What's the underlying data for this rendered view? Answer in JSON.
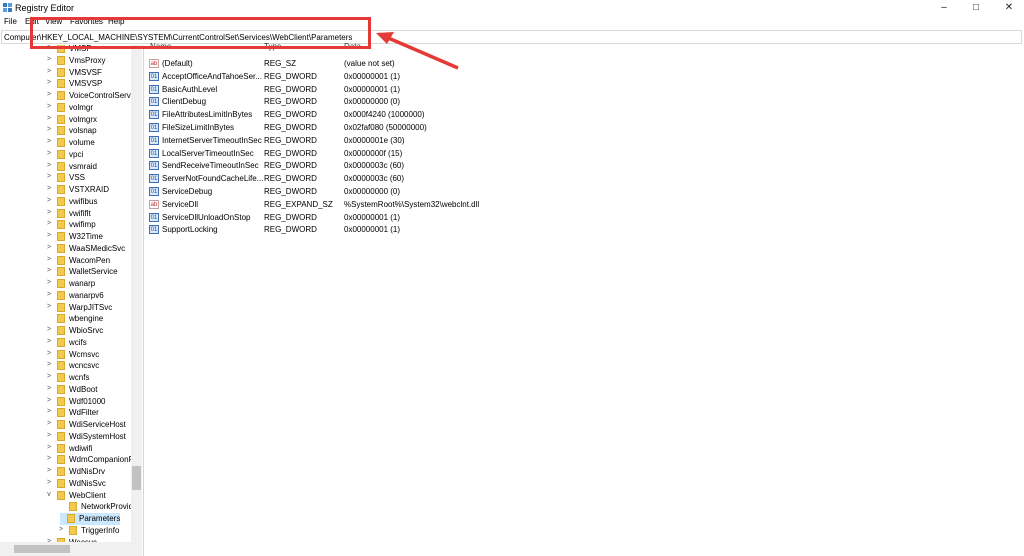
{
  "window": {
    "title": "Registry Editor",
    "controls": [
      {
        "name": "minimize-button",
        "glyph": "–"
      },
      {
        "name": "maximize-button",
        "glyph": "□"
      },
      {
        "name": "close-button",
        "glyph": "✕"
      }
    ]
  },
  "menu": [
    "File",
    "Edit",
    "View",
    "Favorites",
    "Help"
  ],
  "address": "Computer\\HKEY_LOCAL_MACHINE\\SYSTEM\\CurrentControlSet\\Services\\WebClient\\Parameters",
  "tree": [
    {
      "label": "VMSP",
      "chev": ">",
      "depth": 0
    },
    {
      "label": "VmsProxy",
      "chev": ">",
      "depth": 0
    },
    {
      "label": "VMSVSF",
      "chev": ">",
      "depth": 0
    },
    {
      "label": "VMSVSP",
      "chev": ">",
      "depth": 0
    },
    {
      "label": "VoiceControlServi",
      "chev": ">",
      "depth": 0
    },
    {
      "label": "volmgr",
      "chev": ">",
      "depth": 0
    },
    {
      "label": "volmgrx",
      "chev": ">",
      "depth": 0
    },
    {
      "label": "volsnap",
      "chev": ">",
      "depth": 0
    },
    {
      "label": "volume",
      "chev": ">",
      "depth": 0
    },
    {
      "label": "vpci",
      "chev": ">",
      "depth": 0
    },
    {
      "label": "vsmraid",
      "chev": ">",
      "depth": 0
    },
    {
      "label": "VSS",
      "chev": ">",
      "depth": 0
    },
    {
      "label": "VSTXRAID",
      "chev": ">",
      "depth": 0
    },
    {
      "label": "vwifibus",
      "chev": ">",
      "depth": 0
    },
    {
      "label": "vwififlt",
      "chev": ">",
      "depth": 0
    },
    {
      "label": "vwifimp",
      "chev": ">",
      "depth": 0
    },
    {
      "label": "W32Time",
      "chev": ">",
      "depth": 0
    },
    {
      "label": "WaaSMedicSvc",
      "chev": ">",
      "depth": 0
    },
    {
      "label": "WacomPen",
      "chev": ">",
      "depth": 0
    },
    {
      "label": "WalletService",
      "chev": ">",
      "depth": 0
    },
    {
      "label": "wanarp",
      "chev": ">",
      "depth": 0
    },
    {
      "label": "wanarpv6",
      "chev": ">",
      "depth": 0
    },
    {
      "label": "WarpJITSvc",
      "chev": ">",
      "depth": 0
    },
    {
      "label": "wbengine",
      "chev": "",
      "depth": 0
    },
    {
      "label": "WbioSrvc",
      "chev": ">",
      "depth": 0
    },
    {
      "label": "wcifs",
      "chev": ">",
      "depth": 0
    },
    {
      "label": "Wcmsvc",
      "chev": ">",
      "depth": 0
    },
    {
      "label": "wcncsvc",
      "chev": ">",
      "depth": 0
    },
    {
      "label": "wcnfs",
      "chev": ">",
      "depth": 0
    },
    {
      "label": "WdBoot",
      "chev": ">",
      "depth": 0
    },
    {
      "label": "Wdf01000",
      "chev": ">",
      "depth": 0
    },
    {
      "label": "WdFilter",
      "chev": ">",
      "depth": 0
    },
    {
      "label": "WdiServiceHost",
      "chev": ">",
      "depth": 0
    },
    {
      "label": "WdiSystemHost",
      "chev": ">",
      "depth": 0
    },
    {
      "label": "wdiwifi",
      "chev": ">",
      "depth": 0
    },
    {
      "label": "WdmCompanionF",
      "chev": ">",
      "depth": 0
    },
    {
      "label": "WdNisDrv",
      "chev": ">",
      "depth": 0
    },
    {
      "label": "WdNisSvc",
      "chev": ">",
      "depth": 0
    },
    {
      "label": "WebClient",
      "chev": "v",
      "depth": 0
    },
    {
      "label": "NetworkProvid",
      "chev": "",
      "depth": 1
    },
    {
      "label": "Parameters",
      "chev": "",
      "depth": 1,
      "selected": true
    },
    {
      "label": "TriggerInfo",
      "chev": ">",
      "depth": 1
    },
    {
      "label": "Wecsvc",
      "chev": ">",
      "depth": 0
    }
  ],
  "columns": {
    "name": "Name",
    "type": "Type",
    "data": "Data"
  },
  "values": [
    {
      "icon": "ab",
      "name": "(Default)",
      "type": "REG_SZ",
      "data": "(value not set)"
    },
    {
      "icon": "dw",
      "name": "AcceptOfficeAndTahoeSer...",
      "type": "REG_DWORD",
      "data": "0x00000001 (1)"
    },
    {
      "icon": "dw",
      "name": "BasicAuthLevel",
      "type": "REG_DWORD",
      "data": "0x00000001 (1)"
    },
    {
      "icon": "dw",
      "name": "ClientDebug",
      "type": "REG_DWORD",
      "data": "0x00000000 (0)"
    },
    {
      "icon": "dw",
      "name": "FileAttributesLimitInBytes",
      "type": "REG_DWORD",
      "data": "0x000f4240 (1000000)"
    },
    {
      "icon": "dw",
      "name": "FileSizeLimitInBytes",
      "type": "REG_DWORD",
      "data": "0x02faf080 (50000000)"
    },
    {
      "icon": "dw",
      "name": "InternetServerTimeoutInSec",
      "type": "REG_DWORD",
      "data": "0x0000001e (30)"
    },
    {
      "icon": "dw",
      "name": "LocalServerTimeoutInSec",
      "type": "REG_DWORD",
      "data": "0x0000000f (15)"
    },
    {
      "icon": "dw",
      "name": "SendReceiveTimeoutInSec",
      "type": "REG_DWORD",
      "data": "0x0000003c (60)"
    },
    {
      "icon": "dw",
      "name": "ServerNotFoundCacheLife...",
      "type": "REG_DWORD",
      "data": "0x0000003c (60)"
    },
    {
      "icon": "dw",
      "name": "ServiceDebug",
      "type": "REG_DWORD",
      "data": "0x00000000 (0)"
    },
    {
      "icon": "ab",
      "name": "ServiceDll",
      "type": "REG_EXPAND_SZ",
      "data": "%SystemRoot%\\System32\\webclnt.dll"
    },
    {
      "icon": "dw",
      "name": "ServiceDllUnloadOnStop",
      "type": "REG_DWORD",
      "data": "0x00000001 (1)"
    },
    {
      "icon": "dw",
      "name": "SupportLocking",
      "type": "REG_DWORD",
      "data": "0x00000001 (1)"
    }
  ],
  "colors": {
    "highlight": "#e53935",
    "selection": "#cce8ff",
    "folder": "#f4c94f"
  }
}
